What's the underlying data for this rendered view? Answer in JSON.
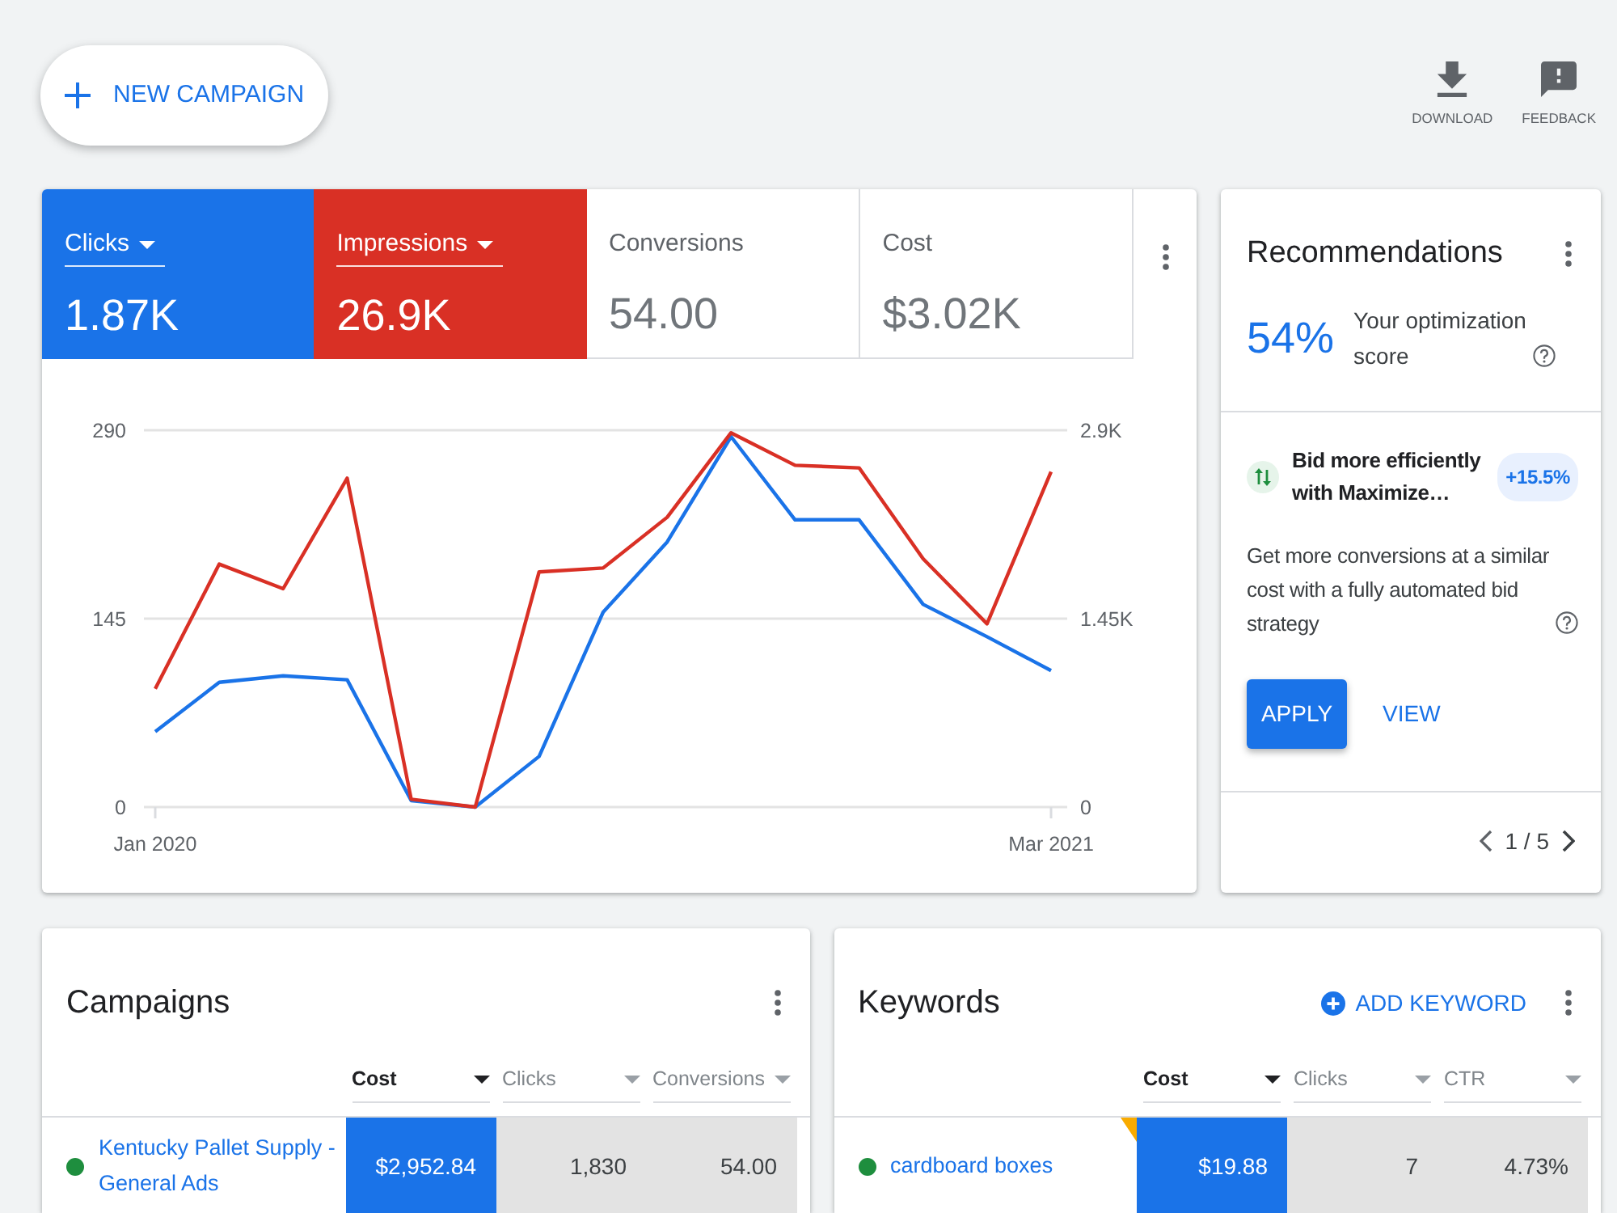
{
  "toolbar": {
    "new_campaign": "NEW CAMPAIGN",
    "actions": [
      {
        "label": "DOWNLOAD",
        "kind": "download"
      },
      {
        "label": "FEEDBACK",
        "kind": "feedback"
      }
    ]
  },
  "performance": {
    "metrics": [
      {
        "label": "Clicks",
        "value": "1.87K",
        "selected": true,
        "color": "#1a73e8"
      },
      {
        "label": "Impressions",
        "value": "26.9K",
        "selected": true,
        "color": "#d93025"
      },
      {
        "label": "Conversions",
        "value": "54.00",
        "selected": false
      },
      {
        "label": "Cost",
        "value": "$3.02K",
        "selected": false
      }
    ],
    "chart_data": {
      "type": "line",
      "categories": [
        "Jan 2020",
        null,
        null,
        null,
        null,
        null,
        null,
        null,
        null,
        null,
        null,
        null,
        null,
        null,
        "Mar 2021"
      ],
      "ylim": [
        0,
        290
      ],
      "yticks": [
        0,
        145,
        290
      ],
      "y2lim": [
        0,
        2900
      ],
      "y2ticks": [
        {
          "value": 0,
          "label": "0"
        },
        {
          "value": 1450,
          "label": "1.45K"
        },
        {
          "value": 2900,
          "label": "2.9K"
        }
      ],
      "series": [
        {
          "color": "#1a73e8",
          "values": [
            58,
            96,
            101,
            98,
            5,
            0,
            39,
            150,
            204,
            285,
            221,
            221,
            156,
            131,
            105
          ]
        },
        {
          "color": "#d93025",
          "axis": "y2",
          "values": [
            910,
            1870,
            1680,
            2530,
            60,
            0,
            1810,
            1840,
            2230,
            2880,
            2630,
            2610,
            1910,
            1410,
            2580
          ]
        }
      ]
    }
  },
  "recommendations": {
    "title": "Recommendations",
    "score": "54%",
    "score_label": "Your optimization score",
    "item": {
      "title": "Bid more efficiently with Maximize…",
      "uplift": "+15.5%",
      "description": "Get more conversions at a similar cost with a fully automated bid strategy",
      "primary_action": "APPLY",
      "secondary_action": "VIEW"
    },
    "pager": "1 / 5"
  },
  "campaigns": {
    "title": "Campaigns",
    "columns": [
      {
        "label": "Cost",
        "selected": true
      },
      {
        "label": "Clicks",
        "selected": false
      },
      {
        "label": "Conversions",
        "selected": false
      }
    ],
    "rows": [
      {
        "name": "Kentucky Pallet Supply - General Ads",
        "color": "#1e8e3e",
        "cells": [
          "$2,952.84",
          "1,830",
          "54.00"
        ]
      }
    ]
  },
  "keywords": {
    "title": "Keywords",
    "add_action": "ADD KEYWORD",
    "columns": [
      {
        "label": "Cost",
        "selected": true
      },
      {
        "label": "Clicks",
        "selected": false
      },
      {
        "label": "CTR",
        "selected": false
      }
    ],
    "rows": [
      {
        "name": "cardboard boxes",
        "color": "#1e8e3e",
        "flagged": true,
        "cells": [
          "$19.88",
          "7",
          "4.73%"
        ]
      }
    ]
  }
}
